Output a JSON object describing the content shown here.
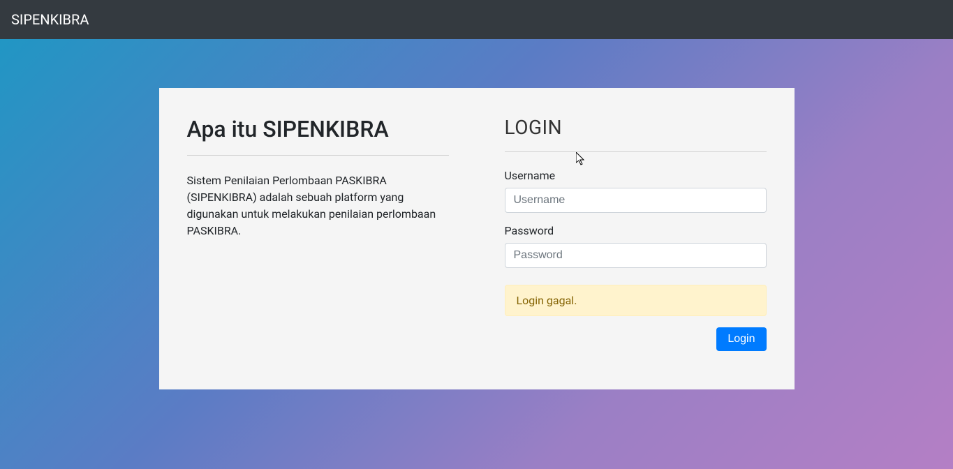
{
  "navbar": {
    "brand": "SIPENKIBRA"
  },
  "about": {
    "title": "Apa itu SIPENKIBRA",
    "description": "Sistem Penilaian Perlombaan PASKIBRA (SIPENKIBRA) adalah sebuah platform yang digunakan untuk melakukan penilaian perlombaan PASKIBRA."
  },
  "login": {
    "title": "LOGIN",
    "username_label": "Username",
    "username_placeholder": "Username",
    "username_value": "",
    "password_label": "Password",
    "password_placeholder": "Password",
    "password_value": "",
    "error_message": "Login gagal.",
    "submit_label": "Login"
  }
}
